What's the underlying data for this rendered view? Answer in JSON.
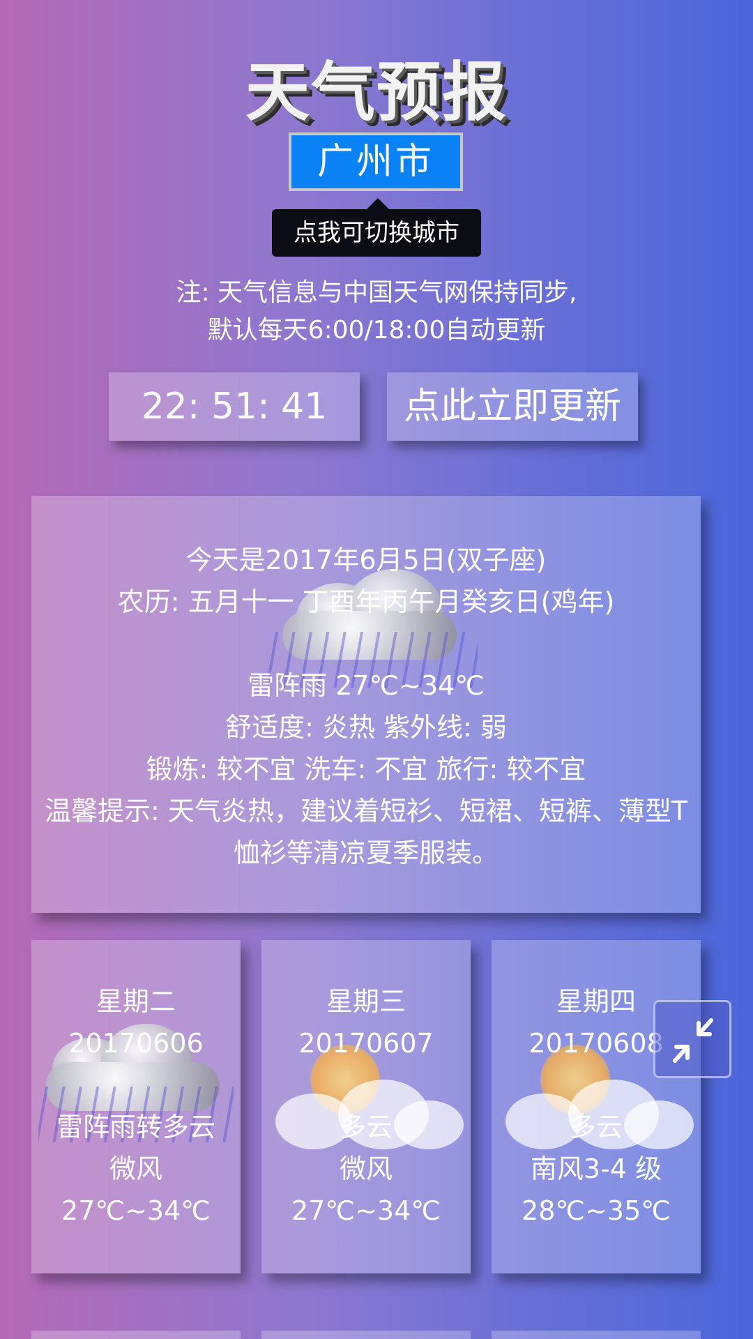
{
  "header": {
    "title": "天气预报",
    "city": "广州市",
    "tooltip": "点我可切换城市"
  },
  "note": {
    "line1": "注: 天气信息与中国天气网保持同步,",
    "line2": "默认每天6:00/18:00自动更新"
  },
  "clock": "22: 51: 41",
  "update_label": "点此立即更新",
  "today": {
    "date_line": "今天是2017年6月5日(双子座)",
    "lunar_line": "农历: 五月十一 丁酉年丙午月癸亥日(鸡年)",
    "weather_line": "雷阵雨 27℃~34℃",
    "comfort_line": "舒适度: 炎热 紫外线: 弱",
    "activity_line": "锻炼: 较不宜 洗车: 不宜 旅行: 较不宜",
    "tip_line": "温馨提示: 天气炎热，建议着短衫、短裙、短裤、薄型T恤衫等清凉夏季服装。",
    "icon": "thunder-rain-cloud-icon"
  },
  "forecast": [
    {
      "weekday": "星期二",
      "date": "20170606",
      "weather": "雷阵雨转多云",
      "wind": "微风",
      "temp": "27℃~34℃",
      "icon": "thunder-rain-cloud-icon"
    },
    {
      "weekday": "星期三",
      "date": "20170607",
      "weather": "多云",
      "wind": "微风",
      "temp": "27℃~34℃",
      "icon": "sun-cloud-icon"
    },
    {
      "weekday": "星期四",
      "date": "20170608",
      "weather": "多云",
      "wind": "南风3-4 级",
      "temp": "28℃~35℃",
      "icon": "sun-cloud-icon"
    }
  ],
  "colors": {
    "city_button": "#0a82f5",
    "tooltip": "#0c0c14",
    "gradient_left": "#b569b5",
    "gradient_right": "#4a66da"
  },
  "floating_button_icon": "shrink-arrows-icon"
}
